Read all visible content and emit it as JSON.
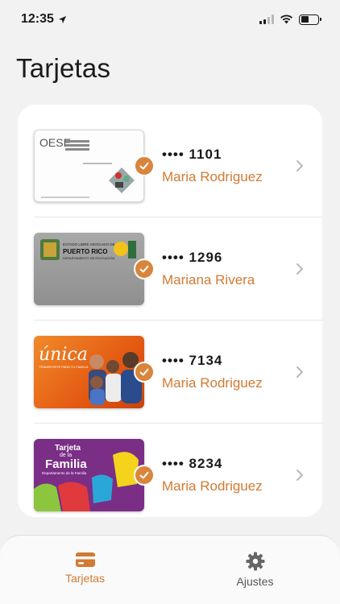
{
  "status_bar": {
    "time": "12:35"
  },
  "header": {
    "title": "Tarjetas"
  },
  "cards": [
    {
      "number": "•••• 1101",
      "owner": "Maria Rodriguez",
      "card_type": "oese-card"
    },
    {
      "number": "•••• 1296",
      "owner": "Mariana Rivera",
      "card_type": "puerto-rico-education-card"
    },
    {
      "number": "•••• 7134",
      "owner": "Maria Rodriguez",
      "card_type": "unica-card"
    },
    {
      "number": "•••• 8234",
      "owner": "Maria Rodriguez",
      "card_type": "tarjeta-de-la-familia-card"
    }
  ],
  "card_art": {
    "oese_letters": "OESE",
    "pr_line1": "ESTADO LIBRE ASOCIADO DE",
    "pr_line2": "PUERTO RICO",
    "pr_line3": "DEPARTAMENTO DE EDUCACIÓN",
    "unica": "única",
    "unica_tag": "TRANSPORTE PARA TU FAMILIA",
    "familia_line1": "Tarjeta",
    "familia_line2": "de la",
    "familia_line3": "Familia",
    "familia_sub": "Departamento de la Familia"
  },
  "tab_bar": {
    "tabs": [
      {
        "label": "Tarjetas",
        "icon": "credit-card-icon",
        "active": true
      },
      {
        "label": "Ajustes",
        "icon": "gear-icon",
        "active": false
      }
    ]
  },
  "colors": {
    "accent": "#d27a32",
    "badge": "#d9853b",
    "background": "#f2f2f2"
  }
}
